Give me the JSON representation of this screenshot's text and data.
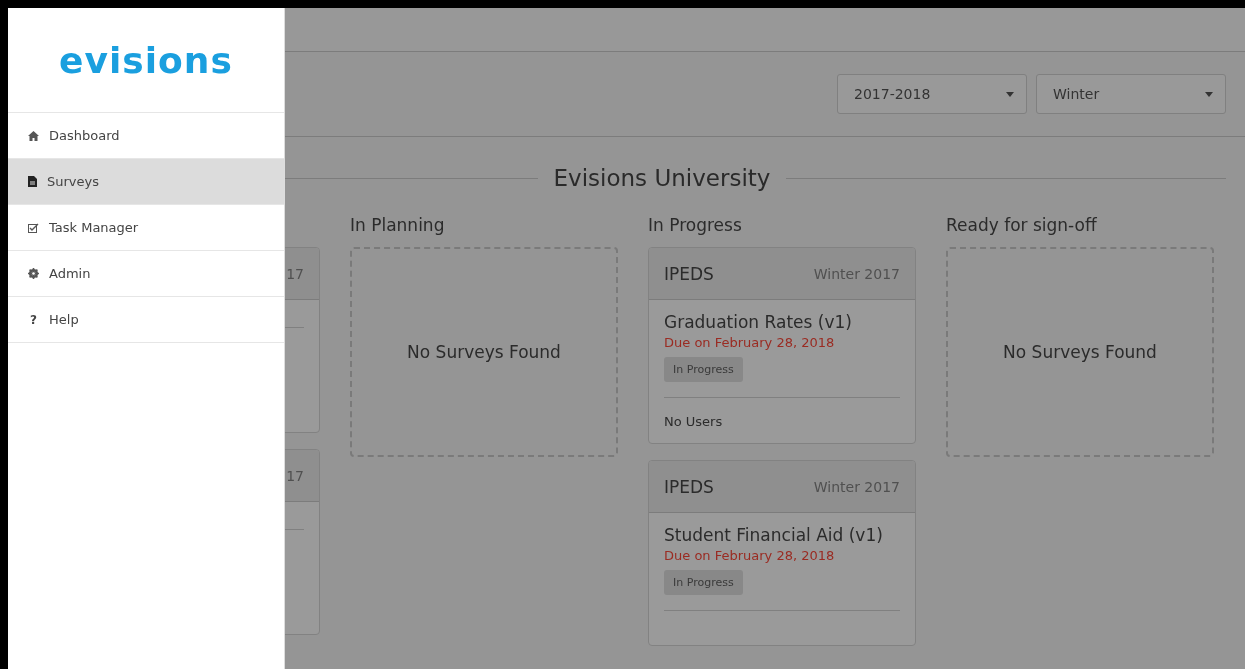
{
  "sidebar": {
    "logo": "evisions",
    "items": [
      {
        "kind": "home",
        "label": "Dashboard",
        "selected": false
      },
      {
        "kind": "file",
        "label": "Surveys",
        "selected": true
      },
      {
        "kind": "check",
        "label": "Task Manager",
        "selected": false
      },
      {
        "kind": "gear",
        "label": "Admin",
        "selected": false
      },
      {
        "kind": "help",
        "glyph": "?",
        "label": "Help",
        "selected": false
      }
    ]
  },
  "filters": [
    {
      "value": "2017-2018"
    },
    {
      "value": "Winter"
    }
  ],
  "title": "Evisions University",
  "columns": [
    {
      "cards": [
        {
          "term": "17"
        },
        {
          "term": "17"
        }
      ]
    },
    {
      "heading": "In Planning",
      "empty": "No Surveys Found"
    },
    {
      "heading": "In Progress",
      "cards": [
        {
          "program": "IPEDS",
          "term": "Winter 2017",
          "title": "Graduation Rates (v1)",
          "due": "Due on February 28, 2018",
          "status": "In Progress",
          "users": "No Users"
        },
        {
          "program": "IPEDS",
          "term": "Winter 2017",
          "title": "Student Financial Aid (v1)",
          "due": "Due on February 28, 2018",
          "status": "In Progress"
        }
      ]
    },
    {
      "heading": "Ready for sign-off",
      "empty": "No Surveys Found"
    }
  ]
}
